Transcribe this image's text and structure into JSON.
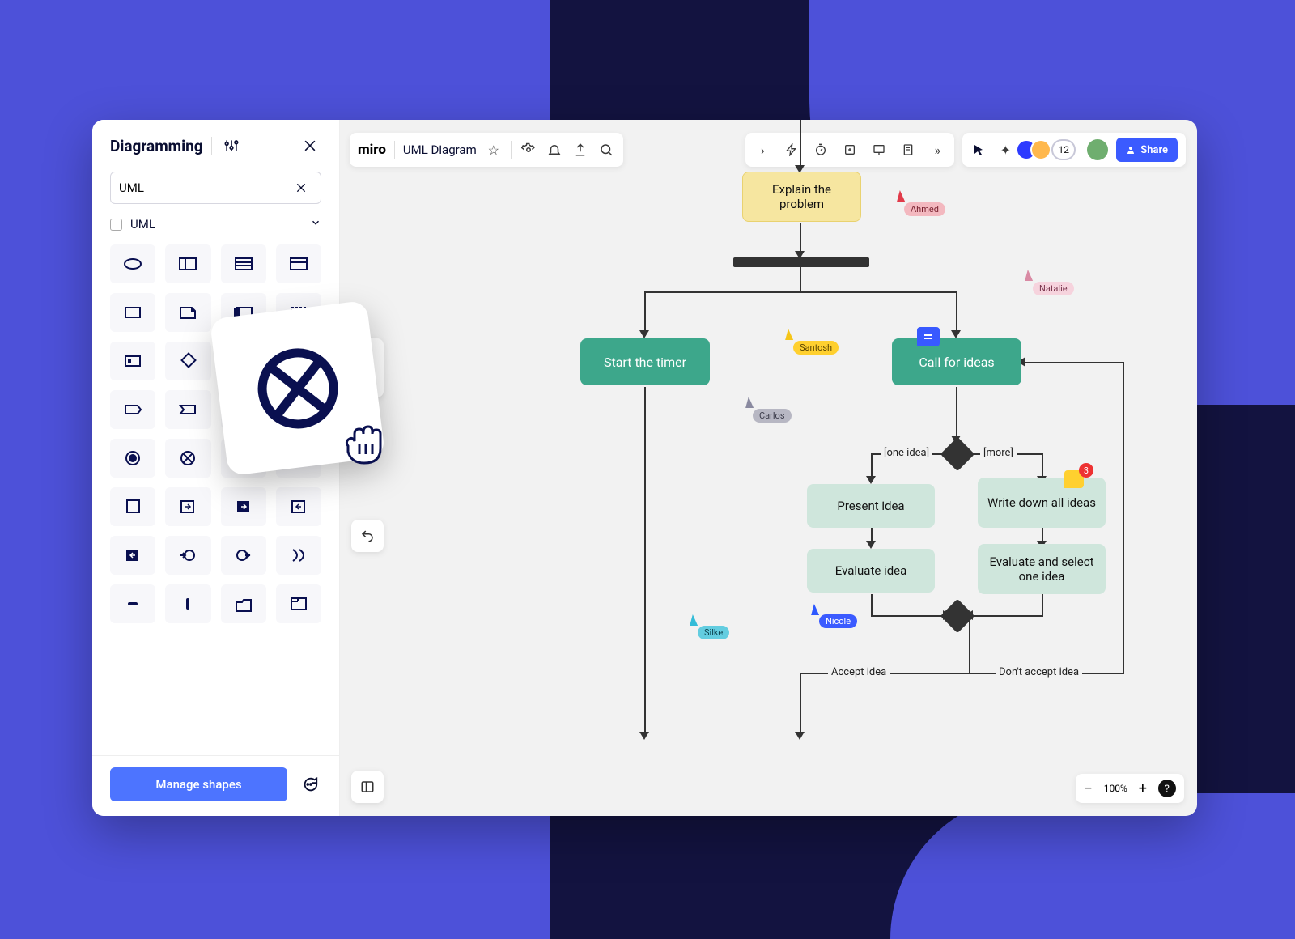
{
  "panel": {
    "title": "Diagramming",
    "search_value": "UML",
    "category": "UML",
    "manage_label": "Manage shapes"
  },
  "topbar": {
    "brand": "miro",
    "doc_title": "UML Diagram",
    "share_label": "Share",
    "avatar_count": "12"
  },
  "cursors": {
    "ahmed": "Ahmed",
    "natalie": "Natalie",
    "santosh": "Santosh",
    "carlos": "Carlos",
    "nicole": "Nicole",
    "silke": "Silke"
  },
  "nodes": {
    "explain": "Explain the problem",
    "start_timer": "Start the timer",
    "call_ideas": "Call for ideas",
    "present": "Present idea",
    "write_down": "Write down all ideas",
    "evaluate": "Evaluate idea",
    "eval_select": "Evaluate and select one idea",
    "one_idea": "[one idea]",
    "more": "[more]",
    "accept": "Accept idea",
    "dont_accept": "Don't accept idea"
  },
  "badge": {
    "count": "3"
  },
  "zoom": {
    "value": "100%"
  },
  "shape_names": [
    "ellipse",
    "package",
    "component",
    "class-table",
    "rectangle",
    "note",
    "port-rect",
    "dashed-rect",
    "object",
    "diamond",
    "rounded-rect",
    "lifeline-head",
    "tag",
    "receive-signal",
    "vertical-bar",
    "send-signal",
    "filled-circle",
    "circle-x",
    "circle-h",
    "circle-dot",
    "square",
    "exit-right",
    "exit-right-filled",
    "exit-left",
    "enter-left",
    "join",
    "merge",
    "flow-final",
    "minus",
    "vbar-short",
    "folder",
    "window"
  ]
}
